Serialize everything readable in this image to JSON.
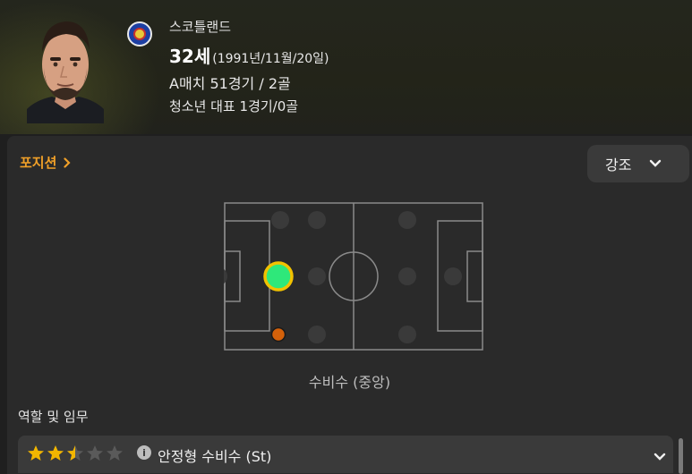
{
  "player": {
    "country": "스코틀랜드",
    "age": "32세",
    "dob": "(1991년/11월/20일)",
    "a_caps": "A매치 51경기 / 2골",
    "youth_caps": "청소년 대표 1경기/0골"
  },
  "panel": {
    "position_link": "포지션",
    "emphasis_button": "강조",
    "position_caption": "수비수 (중앙)",
    "roles_title": "역할 및 임무",
    "role": {
      "text": "안정형 수비수 (St)",
      "rating_stars": 2.5,
      "max_stars": 5
    }
  },
  "colors": {
    "accent": "#f0a028",
    "natural_position": "#2ee87a",
    "natural_ring": "#f2c200",
    "secondary_position": "#d4610a"
  },
  "icons": {
    "flag": "scotland-crest-icon",
    "chevron": "chevron-down-icon",
    "info": "info-icon",
    "link_arrow": "chevron-right-icon"
  }
}
